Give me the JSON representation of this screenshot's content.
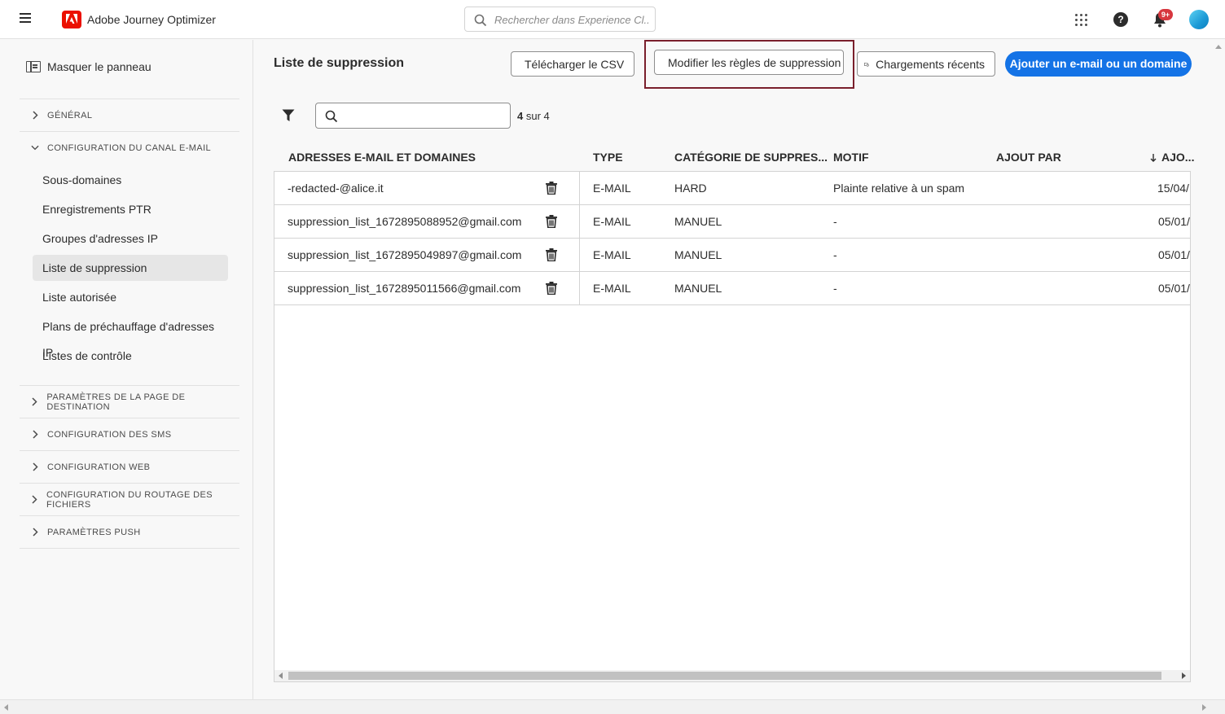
{
  "app": {
    "title": "Adobe Journey Optimizer"
  },
  "global_search": {
    "placeholder": "Rechercher dans Experience Cl..."
  },
  "notifications": {
    "badge": "9+"
  },
  "help": {
    "glyph": "?"
  },
  "sidebar": {
    "hide_panel_label": "Masquer le panneau",
    "sections": [
      {
        "label": "GÉNÉRAL",
        "expanded": false
      },
      {
        "label": "CONFIGURATION DU CANAL E-MAIL",
        "expanded": true,
        "items": [
          {
            "label": "Sous-domaines"
          },
          {
            "label": "Enregistrements PTR"
          },
          {
            "label": "Groupes d'adresses IP"
          },
          {
            "label": "Liste de suppression",
            "active": true
          },
          {
            "label": "Liste autorisée"
          },
          {
            "label": "Plans de préchauffage d'adresses IP"
          },
          {
            "label": "Listes de contrôle"
          }
        ]
      },
      {
        "label": "PARAMÈTRES DE LA PAGE DE DESTINATION",
        "expanded": false
      },
      {
        "label": "CONFIGURATION DES SMS",
        "expanded": false
      },
      {
        "label": "CONFIGURATION WEB",
        "expanded": false
      },
      {
        "label": "CONFIGURATION DU ROUTAGE DES FICHIERS",
        "expanded": false
      },
      {
        "label": "PARAMÈTRES PUSH",
        "expanded": false
      }
    ]
  },
  "main": {
    "title": "Liste de suppression",
    "toolbar": {
      "download_csv": "Télécharger le CSV",
      "edit_rules": "Modifier les règles de suppression",
      "recent_uploads": "Chargements récents",
      "add_button": "Ajouter un e-mail ou un domaine"
    },
    "count": {
      "shown": "4",
      "suffix": "sur 4"
    },
    "table": {
      "headers": [
        "ADRESSES E-MAIL ET DOMAINES",
        "TYPE",
        "CATÉGORIE DE SUPPRES...",
        "MOTIF",
        "AJOUT PAR",
        "AJO..."
      ],
      "rows": [
        [
          "-redacted-@alice.it",
          "E-MAIL",
          "HARD",
          "Plainte relative à un spam",
          "",
          "15/04/..."
        ],
        [
          "suppression_list_1672895088952@gmail.com",
          "E-MAIL",
          "MANUEL",
          "-",
          "",
          "05/01/..."
        ],
        [
          "suppression_list_1672895049897@gmail.com",
          "E-MAIL",
          "MANUEL",
          "-",
          "",
          "05/01/..."
        ],
        [
          "suppression_list_1672895011566@gmail.com",
          "E-MAIL",
          "MANUEL",
          "-",
          "",
          "05/01/..."
        ]
      ]
    }
  },
  "colors": {
    "accent": "#1473e6",
    "brand": "#eb1000",
    "highlight": "#7a1f2c"
  }
}
